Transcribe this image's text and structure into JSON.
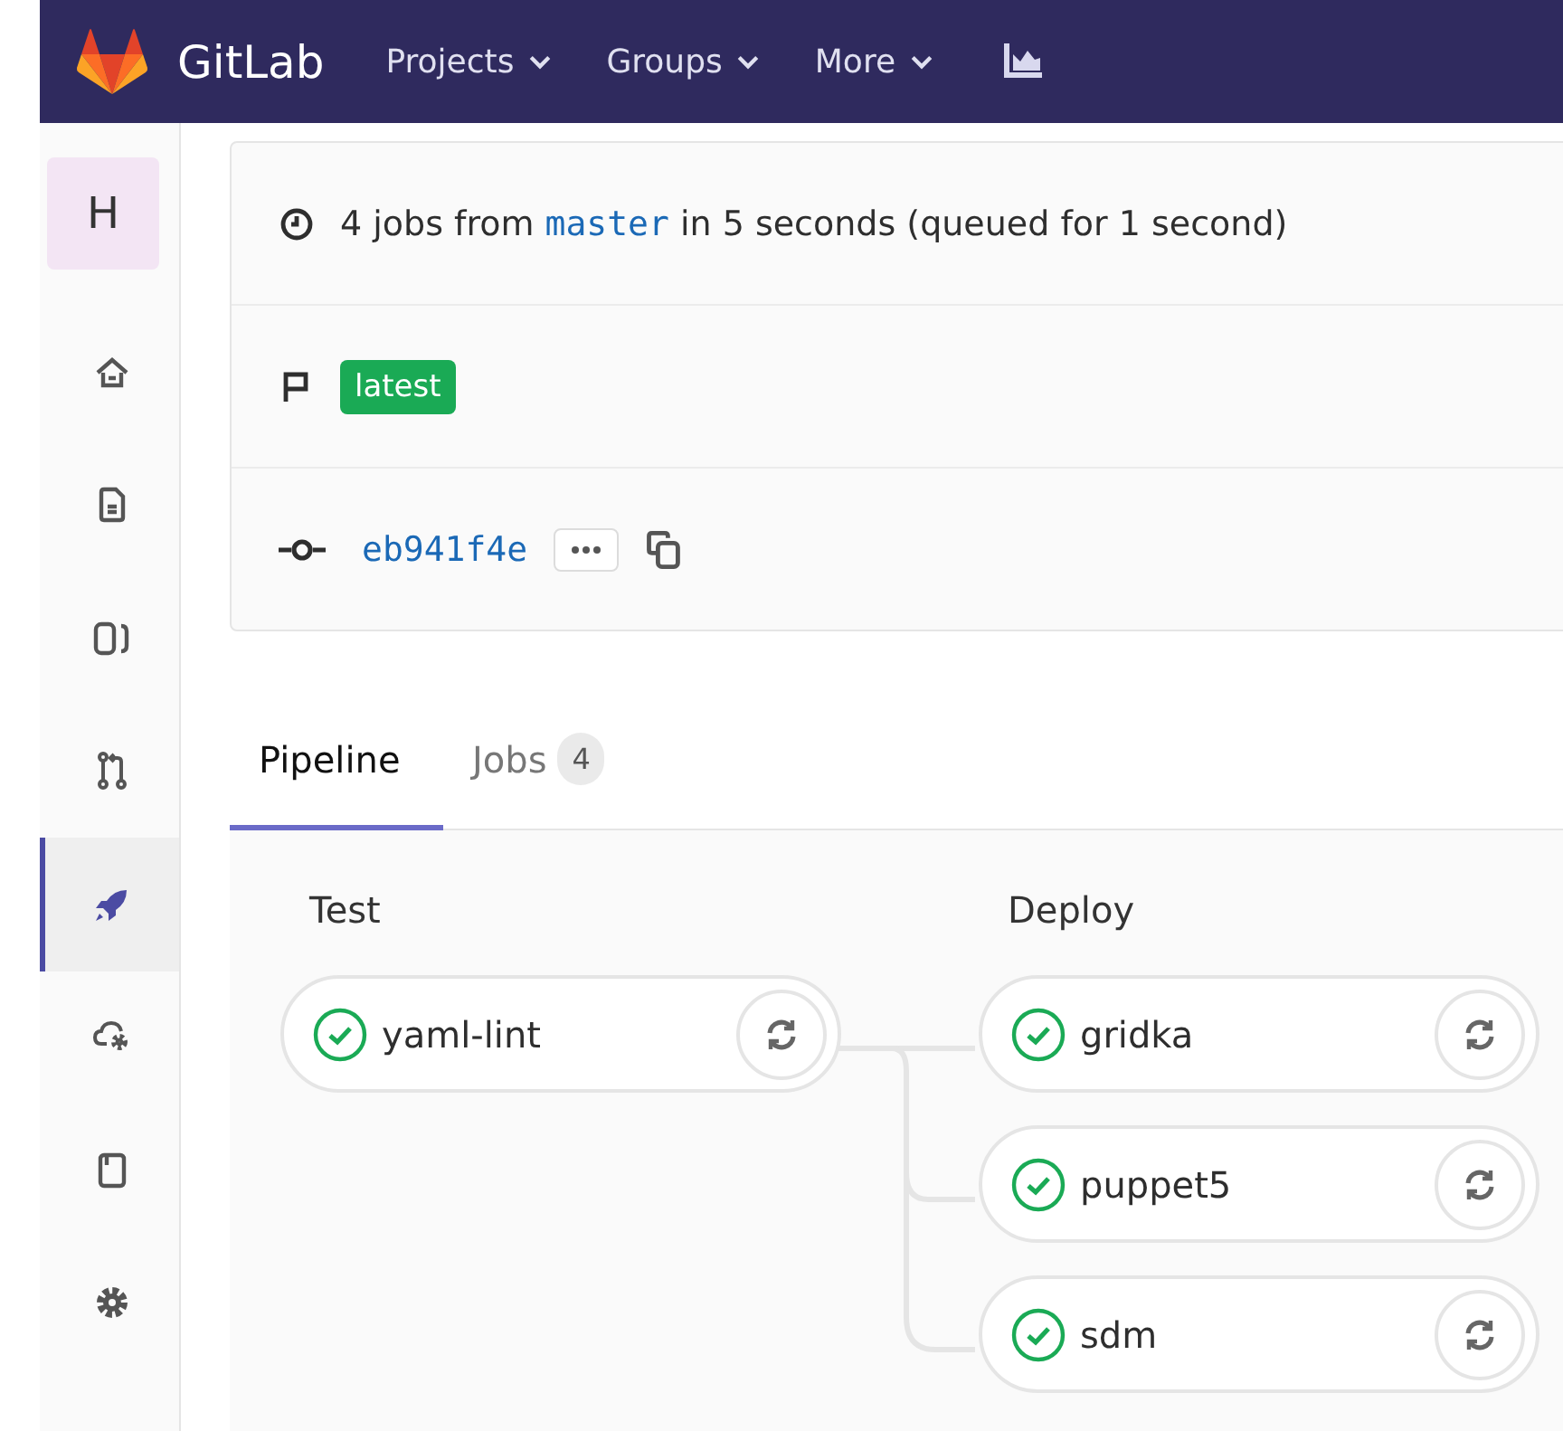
{
  "navbar": {
    "brand": "GitLab",
    "menus": [
      {
        "label": "Projects"
      },
      {
        "label": "Groups"
      },
      {
        "label": "More"
      }
    ]
  },
  "sidebar": {
    "avatar": "H",
    "items": [
      {
        "kind": "home",
        "selected": false
      },
      {
        "kind": "file",
        "selected": false
      },
      {
        "kind": "issues",
        "selected": false
      },
      {
        "kind": "merge",
        "selected": false
      },
      {
        "kind": "rocket",
        "selected": true
      },
      {
        "kind": "cloud",
        "selected": false
      },
      {
        "kind": "book",
        "selected": false
      },
      {
        "kind": "gear",
        "selected": false
      }
    ]
  },
  "pipeline_info": {
    "summary_start": "4 jobs from",
    "branch": "master",
    "summary_end": "in 5 seconds (queued for 1 second)",
    "tag": "latest",
    "commit": "eb941f4e"
  },
  "tabs": [
    {
      "label": "Pipeline",
      "selected": true
    },
    {
      "label": "Jobs",
      "count": "4",
      "selected": false
    }
  ],
  "stages": [
    {
      "title": "Test",
      "jobs": [
        {
          "name": "yaml-lint",
          "passed": true
        }
      ]
    },
    {
      "title": "Deploy",
      "jobs": [
        {
          "name": "gridka",
          "passed": true
        },
        {
          "name": "puppet5",
          "passed": true
        },
        {
          "name": "sdm",
          "passed": true
        }
      ]
    }
  ]
}
